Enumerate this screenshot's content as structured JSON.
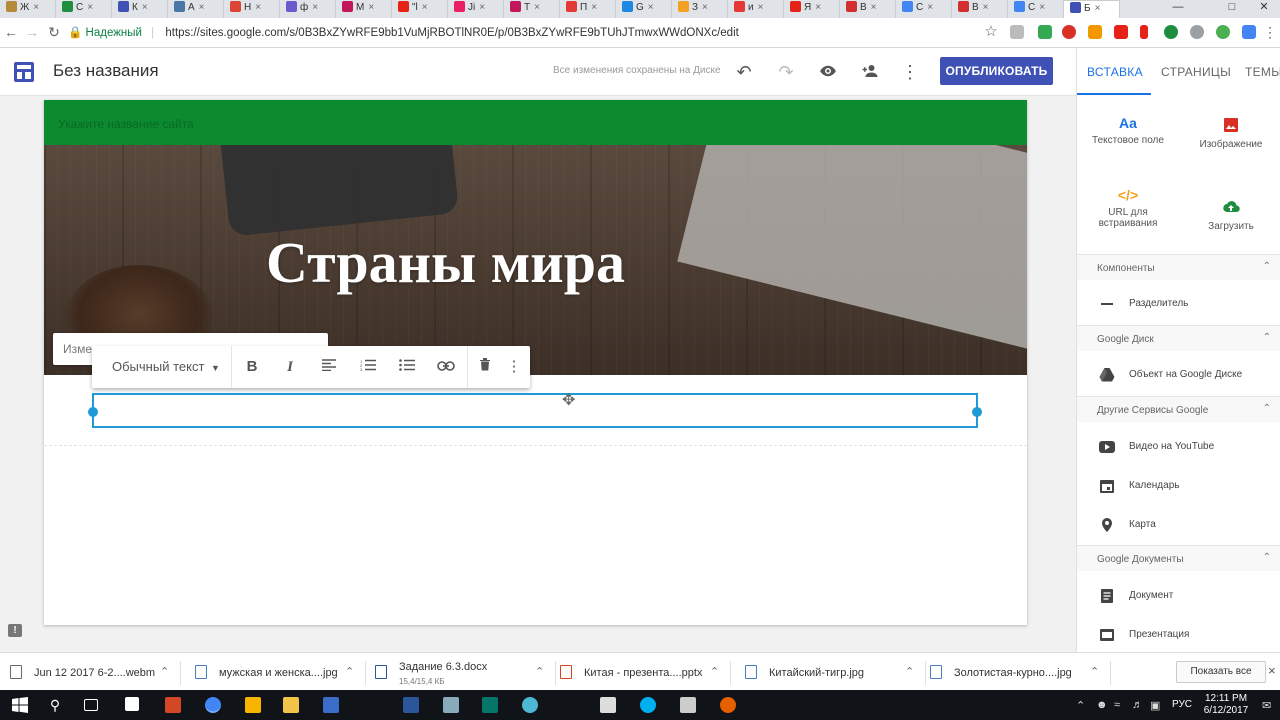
{
  "browser": {
    "tabs": [
      {
        "label": "Ж",
        "color": "#b58a3b"
      },
      {
        "label": "С",
        "color": "#1e8e3e"
      },
      {
        "label": "К",
        "color": "#3f51b5"
      },
      {
        "label": "А",
        "color": "#4a76a8"
      },
      {
        "label": "Н",
        "color": "#db4437"
      },
      {
        "label": "ф",
        "color": "#6a5acd"
      },
      {
        "label": "М",
        "color": "#c2185b"
      },
      {
        "label": "\"l",
        "color": "#e62117"
      },
      {
        "label": "Ji",
        "color": "#e91e63"
      },
      {
        "label": "Т",
        "color": "#c2185b"
      },
      {
        "label": "П",
        "color": "#e53935"
      },
      {
        "label": "G",
        "color": "#1e88e5"
      },
      {
        "label": "З",
        "color": "#f4a020"
      },
      {
        "label": "и",
        "color": "#e53935"
      },
      {
        "label": "Я",
        "color": "#e62117"
      },
      {
        "label": "В",
        "color": "#d32f2f"
      },
      {
        "label": "С",
        "color": "#4285f4"
      },
      {
        "label": "В",
        "color": "#d32f2f"
      },
      {
        "label": "С",
        "color": "#4285f4"
      },
      {
        "label": "Б",
        "color": "#3f51b5",
        "active": true
      }
    ],
    "secure_label": "Надежный",
    "url": "https://sites.google.com/s/0B3BxZYwRFE9bb1VuMjRBOTlNR0E/p/0B3BxZYwRFE9bTUhJTmwxWWdONXc/edit"
  },
  "header": {
    "title": "Без названия",
    "saved_message": "Все изменения сохранены на Диске",
    "publish_label": "ОПУБЛИКОВАТЬ"
  },
  "panel": {
    "tabs": [
      "ВСТАВКА",
      "СТРАНИЦЫ",
      "ТЕМЫ"
    ],
    "insert": {
      "text_box_glyph": "Aa",
      "text_box": "Текстовое поле",
      "image": "Изображение",
      "embed_glyph": "</>",
      "embed_1": "URL для",
      "embed_2": "встраивания",
      "upload": "Загрузить"
    },
    "sections": [
      {
        "title": "Компоненты",
        "items": [
          "Разделитель"
        ]
      },
      {
        "title": "Google Диск",
        "items": [
          "Объект на Google Диске"
        ]
      },
      {
        "title": "Другие Сервисы Google",
        "items": [
          "Видео на YouTube",
          "Календарь",
          "Карта"
        ]
      },
      {
        "title": "Google Документы",
        "items": [
          "Документ",
          "Презентация"
        ]
      }
    ]
  },
  "canvas": {
    "site_name_placeholder": "Укажите название сайта",
    "hero_title": "Страны мира",
    "bg_chip_label": "Изме",
    "text_toolbar": {
      "style_label": "Обычный текст",
      "bold": "B",
      "italic": "I"
    }
  },
  "downloads": {
    "items": [
      {
        "name": "Jun 12 2017 6-2....webm",
        "size": ""
      },
      {
        "name": "мужская и женска....jpg",
        "size": ""
      },
      {
        "name": "Задание 6.3.docx",
        "size": "15,4/15,4 КБ"
      },
      {
        "name": "Китая - презента....pptx",
        "size": ""
      },
      {
        "name": "Китайский-тигр.jpg",
        "size": ""
      },
      {
        "name": "Золотистая-курно....jpg",
        "size": ""
      }
    ],
    "show_all": "Показать все"
  },
  "taskbar": {
    "lang": "РУС",
    "time": "12:11 PM",
    "date": "6/12/2017"
  }
}
